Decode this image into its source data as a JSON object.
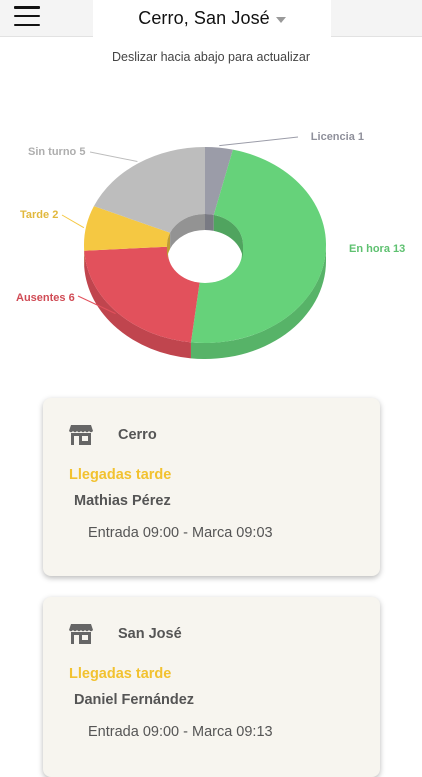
{
  "header": {
    "location_title": "Cerro, San José",
    "icons": {
      "menu": "hamburger-menu-icon",
      "dropdown": "caret-down-icon"
    }
  },
  "refresh_hint": "Deslizar hacia abajo para actualizar",
  "chart_data": {
    "type": "pie",
    "variant": "3d-donut",
    "slices": [
      {
        "label": "Licencia 1",
        "name": "Licencia",
        "value": 1,
        "color": "#9b9ca8"
      },
      {
        "label": "En hora 13",
        "name": "En hora",
        "value": 13,
        "color": "#66d27a"
      },
      {
        "label": "Ausentes 6",
        "name": "Ausentes",
        "value": 6,
        "color": "#e2515c"
      },
      {
        "label": "Tarde 2",
        "name": "Tarde",
        "value": 2,
        "color": "#f5c842"
      },
      {
        "label": "Sin turno 5",
        "name": "Sin turno",
        "value": 5,
        "color": "#bdbdbd"
      }
    ]
  },
  "cards": [
    {
      "title": "Cerro",
      "section": "Llegadas tarde",
      "person": "Mathias Pérez",
      "detail": "Entrada 09:00 - Marca 09:03",
      "icon": "store-icon"
    },
    {
      "title": "San José",
      "section": "Llegadas tarde",
      "person": "Daniel Fernández",
      "detail": "Entrada 09:00 - Marca 09:13",
      "icon": "store-icon"
    }
  ],
  "colors": {
    "accent_yellow": "#f2c230",
    "card_bg": "#f7f5ef"
  }
}
